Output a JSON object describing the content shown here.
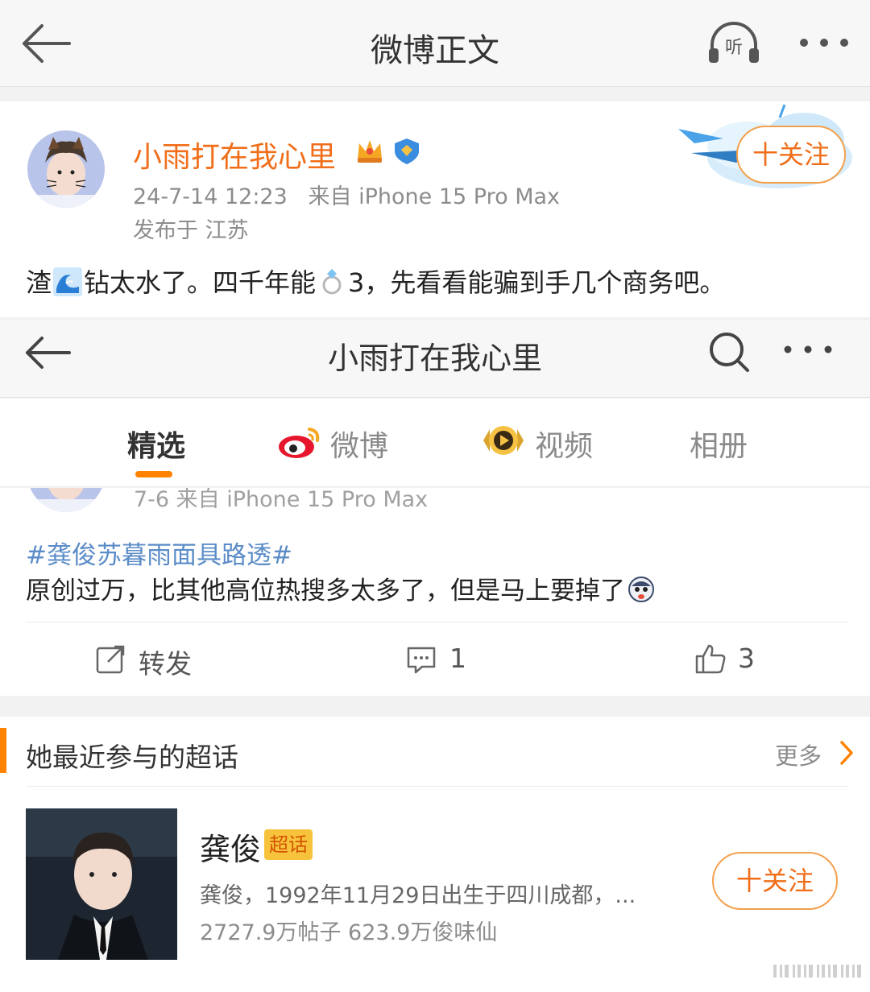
{
  "topbar": {
    "title": "微博正文",
    "listen_label": "听"
  },
  "post": {
    "username": "小雨打在我心里",
    "date": "24-7-14 12:23",
    "source": "来自 iPhone 15 Pro Max",
    "location": "发布于 江苏",
    "follow_label": "十关注",
    "text_part1": "渣",
    "text_part2": "钻太水了。四千年能",
    "text_part3": "3，先看看能骗到手几个商务吧。"
  },
  "profile": {
    "title": "小雨打在我心里",
    "tabs": [
      "精选",
      "微博",
      "视频",
      "相册"
    ]
  },
  "feed": {
    "meta": "7-6   来自 iPhone 15 Pro Max",
    "hashtag": "#龚俊苏暮雨面具路透#",
    "body": "原创过万，比其他高位热搜多太多了，但是马上要掉了",
    "repost_label": "转发",
    "comment_count": "1",
    "like_count": "3"
  },
  "topics": {
    "heading": "她最近参与的超话",
    "more_label": "更多",
    "name": "龚俊",
    "badge": "超话",
    "description": "龚俊，1992年11月29日出生于四川成都，...",
    "stats": "2727.9万帖子 623.9万俊味仙",
    "follow_label": "十关注"
  },
  "colors": {
    "accent_orange": "#f06e19",
    "tab_underline": "#ff8200",
    "link_blue": "#5b8cc7"
  },
  "icons": [
    "back-arrow-icon",
    "listen-headphone-icon",
    "more-dots-icon",
    "search-icon",
    "weibo-logo-icon",
    "video-icon",
    "repost-icon",
    "comment-icon",
    "like-icon",
    "chevron-right-icon",
    "wave-emoji-icon",
    "ring-emoji-icon",
    "shocked-emoji-icon",
    "crown-badge-icon",
    "verified-badge-icon"
  ]
}
